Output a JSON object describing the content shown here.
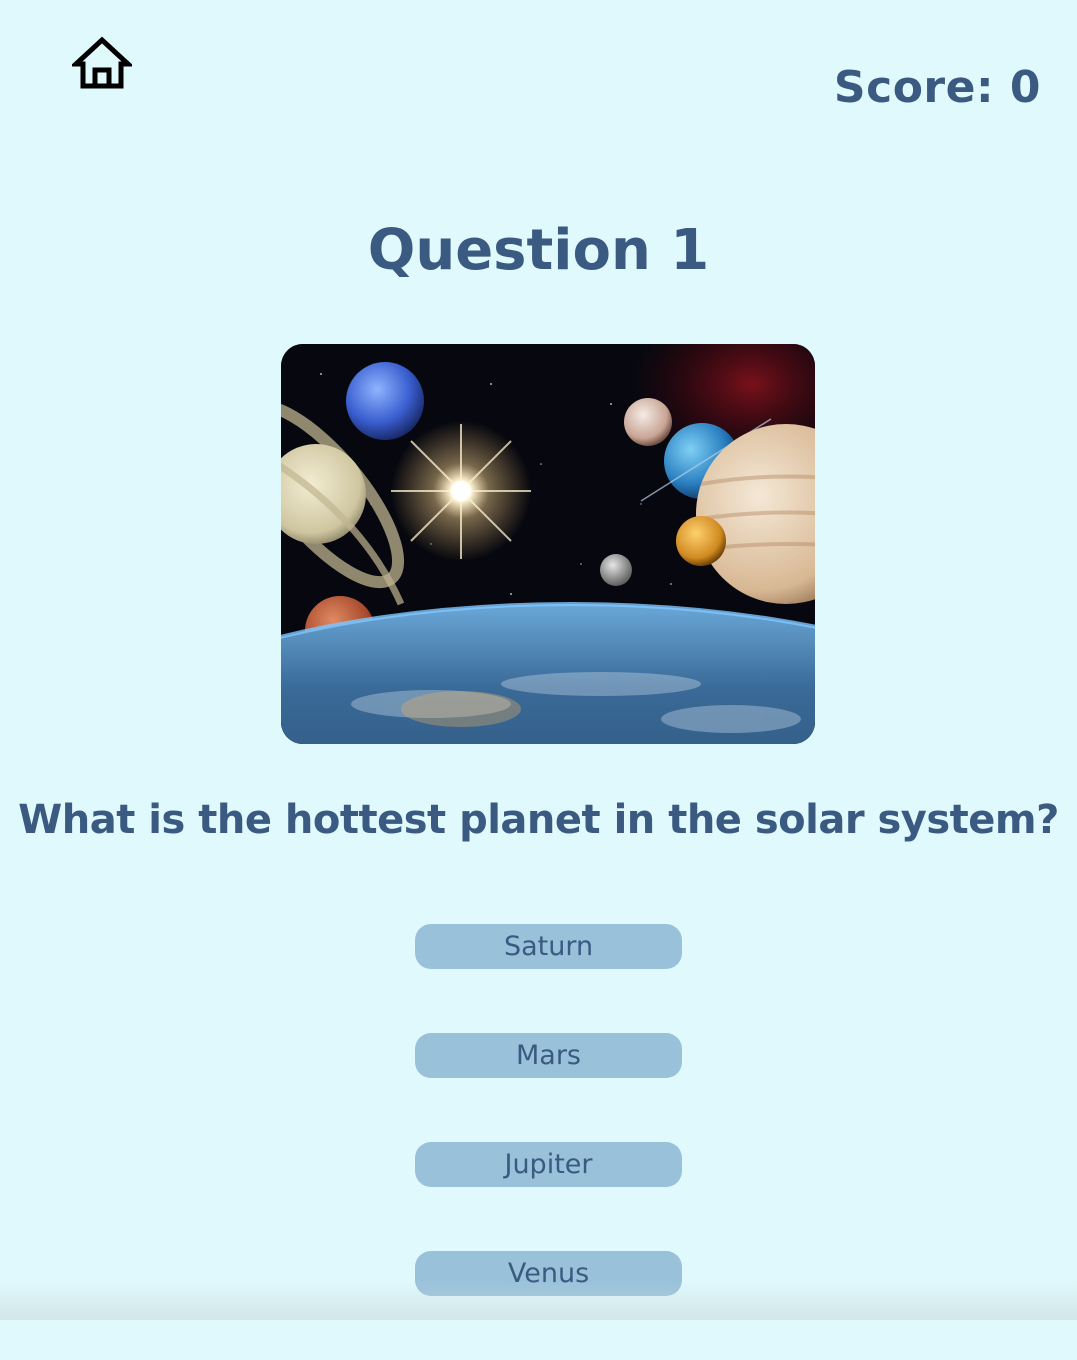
{
  "header": {
    "home_icon": "home-icon",
    "score_label": "Score: 0"
  },
  "quiz": {
    "question_title": "Question 1",
    "image_subject": "solar-system-planets-image",
    "question_text": "What is the hottest planet in the solar system?",
    "answers": [
      {
        "label": "Saturn"
      },
      {
        "label": "Mars"
      },
      {
        "label": "Jupiter"
      },
      {
        "label": "Venus"
      }
    ]
  },
  "colors": {
    "background": "#e0f9fc",
    "text": "#3b5a82",
    "answer_button": "#99c2da"
  }
}
